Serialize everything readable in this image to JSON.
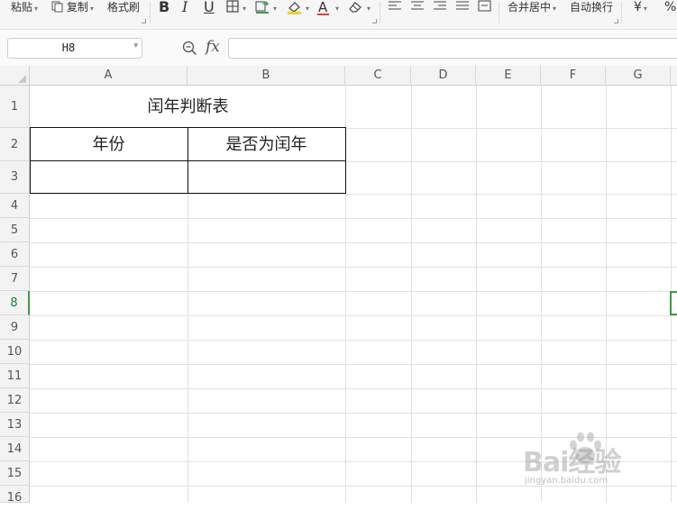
{
  "ribbon": {
    "paste_label": "粘贴",
    "copy_label": "复制",
    "format_painter_label": "格式刷",
    "bold_label": "B",
    "italic_label": "I",
    "underline_label": "U",
    "font_color_label": "A",
    "merge_center_label": "合并居中",
    "wrap_text_label": "自动换行",
    "currency_label": "¥",
    "percent_label": "%"
  },
  "formula_bar": {
    "name_box": "H8",
    "fx_label": "fx",
    "formula": ""
  },
  "sheet": {
    "columns": [
      "A",
      "B",
      "C",
      "D",
      "E",
      "F",
      "G"
    ],
    "rows": [
      "1",
      "2",
      "3",
      "4",
      "5",
      "6",
      "7",
      "8",
      "9",
      "10",
      "11",
      "12",
      "13",
      "14",
      "15",
      "16"
    ],
    "active_row": "8",
    "cells": {
      "A1": "闰年判断表",
      "A2": "年份",
      "B2": "是否为闰年",
      "A3": "",
      "B3": ""
    }
  },
  "colors": {
    "selection": "#3d9a45",
    "header_bg": "#f3f3f3"
  },
  "watermark": {
    "text": "Bai经验",
    "url": "jingyan.baidu.com"
  }
}
